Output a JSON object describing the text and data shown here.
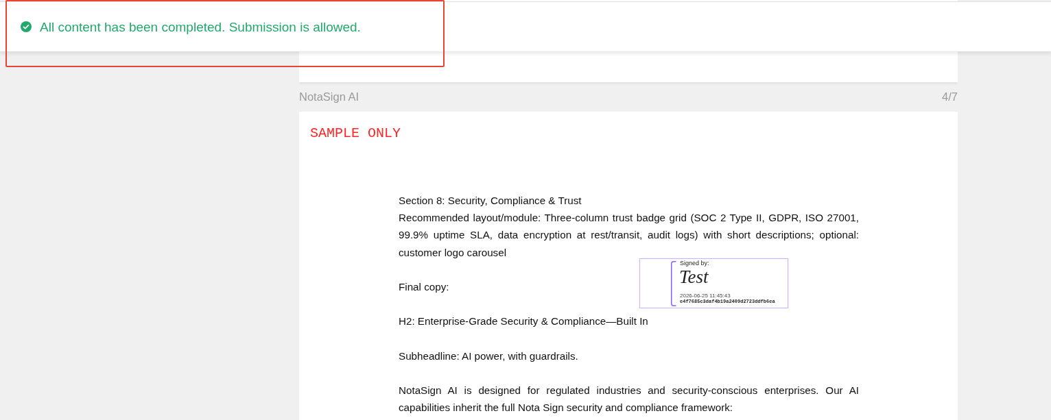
{
  "notification": {
    "kind": "success",
    "message": "All content has been completed. Submission is allowed.",
    "highlighted": true
  },
  "document": {
    "title": "NotaSign AI",
    "page_number": "4/7",
    "sample_label": "SAMPLE ONLY",
    "blocks": [
      {
        "paragraphs": [
          "Section 8: Security, Compliance & Trust",
          "Recommended layout/module: Three-column trust badge grid (SOC 2 Type II, GDPR, ISO 27001, 99.9% uptime SLA, data encryption at rest/transit, audit logs) with short descriptions; optional: customer logo carousel"
        ]
      },
      {
        "paragraphs": [
          "Final copy:"
        ]
      },
      {
        "paragraphs": [
          "H2: Enterprise-Grade Security & Compliance—Built In"
        ]
      },
      {
        "paragraphs": [
          "Subheadline: AI power, with guardrails."
        ]
      },
      {
        "paragraphs": [
          "NotaSign AI is designed for regulated industries and security-conscious enterprises. Our AI capabilities inherit the full Nota Sign security and compliance framework:"
        ]
      }
    ],
    "signature": {
      "label": "Signed by:",
      "name": "Test",
      "timestamp": "2026-06-25 11:45:43",
      "hash": "e4f7685c3daf4b19a2409d2723ddfb6ea"
    }
  }
}
